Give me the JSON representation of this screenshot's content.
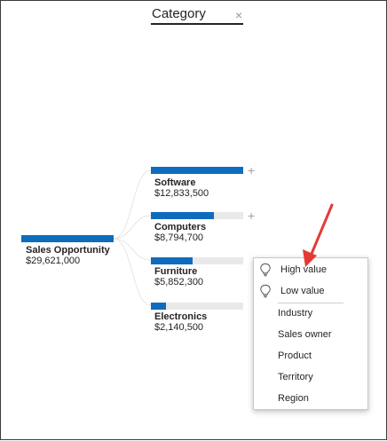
{
  "header": {
    "title": "Category",
    "close_glyph": "×"
  },
  "root": {
    "label": "Sales Opportunity",
    "value": "$29,621,000"
  },
  "nodes": [
    {
      "label": "Software",
      "value": "$12,833,500",
      "fraction": 1.0
    },
    {
      "label": "Computers",
      "value": "$8,794,700",
      "fraction": 0.685
    },
    {
      "label": "Furniture",
      "value": "$5,852,300",
      "fraction": 0.456
    },
    {
      "label": "Electronics",
      "value": "$2,140,500",
      "fraction": 0.167
    }
  ],
  "expand_glyph": "+",
  "menu": {
    "ai_items": [
      {
        "label": "High value",
        "icon": "lightbulb-icon"
      },
      {
        "label": "Low value",
        "icon": "lightbulb-icon"
      }
    ],
    "field_items": [
      "Industry",
      "Sales owner",
      "Product",
      "Territory",
      "Region"
    ]
  },
  "colors": {
    "bar": "#0f6cbd",
    "track": "#e9e9e9",
    "arrow": "#e53935"
  }
}
